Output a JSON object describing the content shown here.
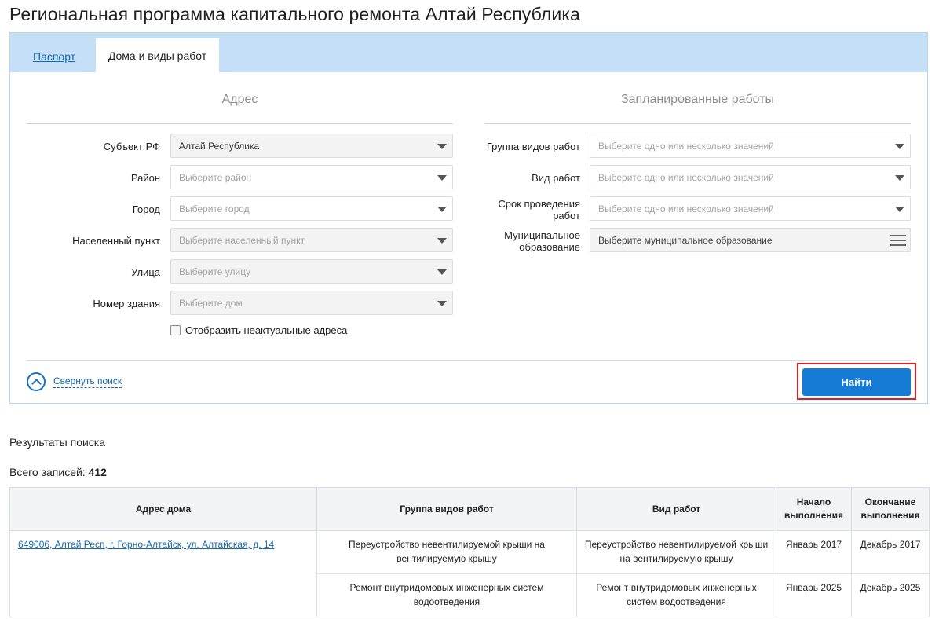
{
  "page": {
    "title": "Региональная программа капитального ремонта Алтай Республика"
  },
  "tabs": [
    {
      "label": "Паспорт"
    },
    {
      "label": "Дома и виды работ"
    }
  ],
  "address_section": {
    "title": "Адрес",
    "fields": [
      {
        "label": "Субъект РФ",
        "value": "Алтай Республика"
      },
      {
        "label": "Район",
        "placeholder": "Выберите район"
      },
      {
        "label": "Город",
        "placeholder": "Выберите город"
      },
      {
        "label": "Населенный пункт",
        "placeholder": "Выберите населенный пункт"
      },
      {
        "label": "Улица",
        "placeholder": "Выберите улицу"
      },
      {
        "label": "Номер здания",
        "placeholder": "Выберите дом"
      }
    ],
    "checkbox_label": "Отобразить неактуальные адреса"
  },
  "works_section": {
    "title": "Запланированные работы",
    "fields": [
      {
        "label": "Группа видов работ",
        "placeholder": "Выберите одно или несколько значений"
      },
      {
        "label": "Вид работ",
        "placeholder": "Выберите одно или несколько значений"
      },
      {
        "label_line1": "Срок проведения",
        "label_line2": "работ",
        "placeholder": "Выберите одно или несколько значений"
      },
      {
        "label_line1": "Муниципальное",
        "label_line2": "образование",
        "placeholder": "Выберите муниципальное образование"
      }
    ]
  },
  "actions": {
    "collapse_label": "Свернуть поиск",
    "find_label": "Найти"
  },
  "results": {
    "label": "Результаты поиска",
    "total_label": "Всего записей:",
    "total_value": "412",
    "columns": {
      "address": "Адрес дома",
      "group": "Группа видов работ",
      "work": "Вид работ",
      "start_line1": "Начало",
      "start_line2": "выполнения",
      "end_line1": "Окончание",
      "end_line2": "выполнения"
    },
    "address": "649006, Алтай Респ, г. Горно-Алтайск, ул. Алтайская, д. 14",
    "rows": [
      {
        "group": "Переустройство невентилируемой крыши на вентилируемую крышу",
        "work": "Переустройство невентилируемой крыши на вентилируемую крышу",
        "start": "Январь 2017",
        "end": "Декабрь 2017"
      },
      {
        "group": "Ремонт внутридомовых инженерных систем водоотведения",
        "work": "Ремонт внутридомовых инженерных систем водоотведения",
        "start": "Январь 2025",
        "end": "Декабрь 2025"
      }
    ]
  }
}
